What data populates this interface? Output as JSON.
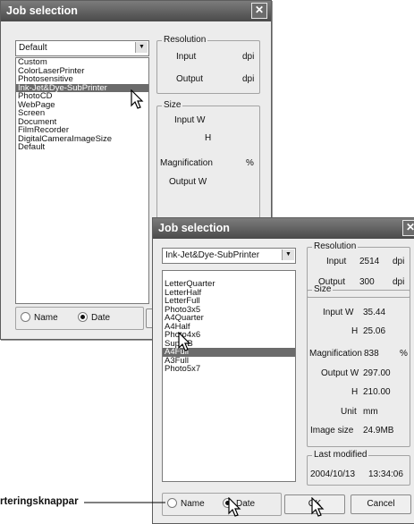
{
  "back_dialog": {
    "title": "Job selection",
    "close_glyph": "✕",
    "combo_value": "Default",
    "list_items": [
      "Custom",
      "ColorLaserPrinter",
      "Photosensitive",
      "Ink-Jet&Dye-SubPrinter",
      "PhotoCD",
      "WebPage",
      "Screen",
      "Document",
      "FilmRecorder",
      "DigitalCameraImageSize",
      "Default"
    ],
    "resolution": {
      "legend": "Resolution",
      "input_label": "Input",
      "output_label": "Output",
      "unit": "dpi"
    },
    "size": {
      "legend": "Size",
      "input_w_label": "Input W",
      "h_label": "H",
      "magnification_label": "Magnification",
      "mag_unit": "%",
      "output_w_label": "Output W"
    },
    "sort": {
      "name_label": "Name",
      "date_label": "Date",
      "selected": "Date"
    }
  },
  "front_dialog": {
    "title": "Job selection",
    "close_glyph": "✕",
    "combo_value": "Ink-Jet&Dye-SubPrinter",
    "list_items": [
      "LetterQuarter",
      "LetterHalf",
      "LetterFull",
      "Photo3x5",
      "A4Quarter",
      "A4Half",
      "Photo4x6",
      "SuperB",
      "A4Full",
      "A3Full",
      "Photo5x7"
    ],
    "selected_item": "A4Full",
    "resolution": {
      "legend": "Resolution",
      "input_label": "Input",
      "input_value": "2514",
      "output_label": "Output",
      "output_value": "300",
      "unit": "dpi"
    },
    "size": {
      "legend": "Size",
      "input_w_label": "Input W",
      "input_w_value": "35.44",
      "h_label": "H",
      "h_value": "25.06",
      "magnification_label": "Magnification",
      "magnification_value": "838",
      "mag_unit": "%",
      "output_w_label": "Output W",
      "output_w_value": "297.00",
      "output_h_label": "H",
      "output_h_value": "210.00",
      "unit_label": "Unit",
      "unit_value": "mm",
      "image_size_label": "Image size",
      "image_size_value": "24.9MB"
    },
    "last_modified": {
      "legend": "Last modified",
      "date": "2004/10/13",
      "time": "13:34:06"
    },
    "sort": {
      "name_label": "Name",
      "date_label": "Date",
      "selected": "Date"
    },
    "ok_label": "OK",
    "cancel_label": "Cancel"
  },
  "callout_label": "rteringsknappar",
  "colors": {
    "titlebar": "#5a5a5a",
    "dialog_bg": "#ececec",
    "selection": "#6b6b6b"
  },
  "icons": [
    "close-icon",
    "dropdown-arrow-icon",
    "mouse-pointer-icon"
  ]
}
